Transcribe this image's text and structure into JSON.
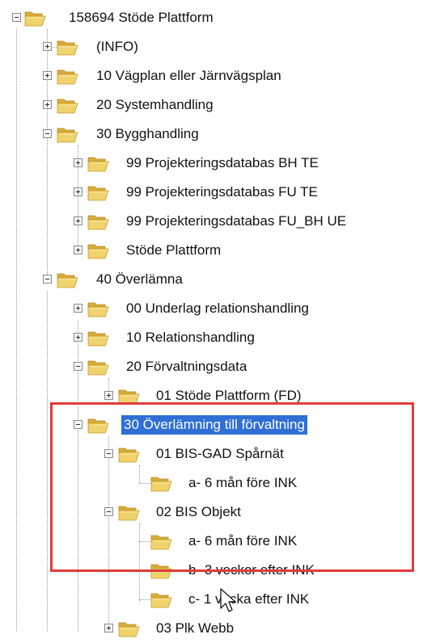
{
  "tree": {
    "root": {
      "label": "158694 Stöde Plattform",
      "expanded": true
    },
    "level1": [
      {
        "label": "(INFO)",
        "expanded": false
      },
      {
        "label": "10 Vägplan eller Järnvägsplan",
        "expanded": false
      },
      {
        "label": "20 Systemhandling",
        "expanded": false
      },
      {
        "label": "30 Bygghandling",
        "expanded": true
      },
      {
        "label": "40 Överlämna",
        "expanded": true
      }
    ],
    "bygghandling_children": [
      {
        "label": "99 Projekteringsdatabas BH TE",
        "expanded": false
      },
      {
        "label": "99 Projekteringsdatabas FU TE",
        "expanded": false
      },
      {
        "label": "99 Projekteringsdatabas FU_BH UE",
        "expanded": false
      },
      {
        "label": "Stöde Plattform",
        "expanded": false
      }
    ],
    "overlamna_children": [
      {
        "label": "00 Underlag relationshandling",
        "expanded": false
      },
      {
        "label": "10 Relationshandling",
        "expanded": false
      },
      {
        "label": "20 Förvaltningsdata",
        "expanded": true
      },
      {
        "label": "01 Stöde Plattform (FD)",
        "expanded": false
      },
      {
        "label": "30 Överlämning till förvaltning",
        "expanded": true,
        "selected": true
      }
    ],
    "overlamning_children": [
      {
        "label": "01 BIS-GAD Spårnät",
        "expanded": true
      },
      {
        "label": "a- 6 mån före INK"
      },
      {
        "label": "02 BIS Objekt",
        "expanded": true
      },
      {
        "label": "a- 6 mån före INK"
      },
      {
        "label": "b- 3 veckor efter INK"
      },
      {
        "label": "c- 1 vecka efter INK"
      },
      {
        "label": "03 Plk Webb",
        "expanded": false
      }
    ]
  },
  "colors": {
    "selection": "#2f6fd6",
    "highlight_box": "#e23b3b",
    "folder": "#e8c45a"
  },
  "icons": {
    "folder": "open-folder-icon",
    "expand": "plus-box-icon",
    "collapse": "minus-box-icon",
    "cursor": "mouse-pointer-icon"
  }
}
